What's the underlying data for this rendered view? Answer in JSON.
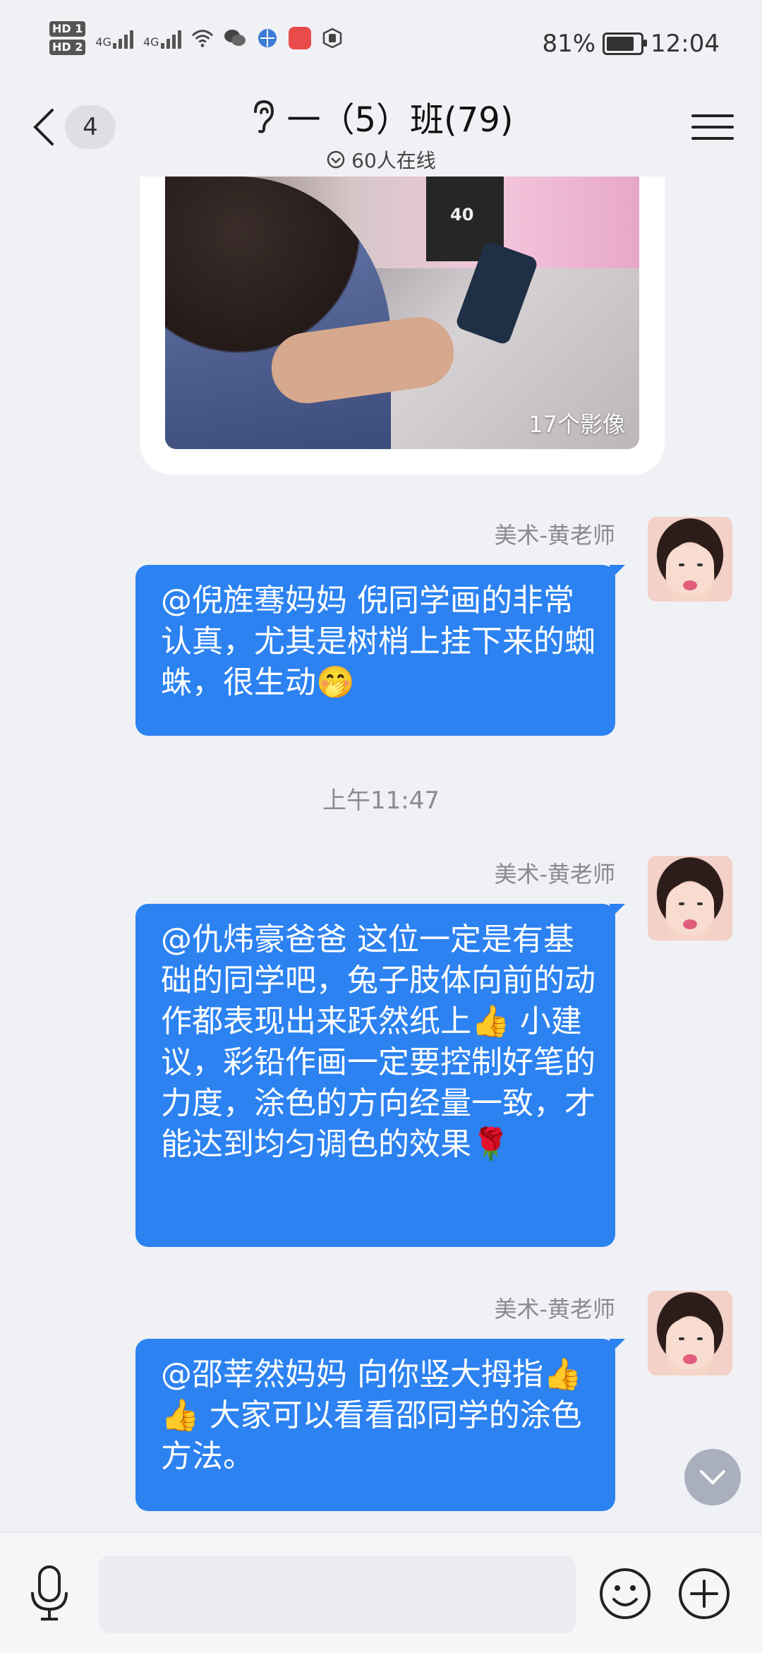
{
  "status_bar": {
    "hd1": "HD 1",
    "hd2": "HD 2",
    "net1": "4G",
    "net2": "4G",
    "battery": "81%",
    "time": "12:04",
    "icons": [
      "wifi-icon",
      "wechat-icon",
      "browser-icon",
      "huawei-icon",
      "hand-icon"
    ]
  },
  "nav": {
    "back_count": "4",
    "title": "一（5）班(79)",
    "online": "60人在线",
    "icons": {
      "ear": "ear-icon",
      "menu": "menu-icon",
      "online": "check-circle-icon"
    }
  },
  "image_message": {
    "count_label": "17个影像",
    "box_text": "40"
  },
  "messages": [
    {
      "sender": "美术-黄老师",
      "text": "@倪旌骞妈妈 倪同学画的非常认真，尤其是树梢上挂下来的蜘蛛，很生动🤭"
    },
    {
      "sender": "美术-黄老师",
      "text": "@仇炜豪爸爸 这位一定是有基础的同学吧，兔子肢体向前的动作都表现出来跃然纸上👍 小建议，彩铅作画一定要控制好笔的力度，涂色的方向经量一致，才能达到均匀调色的效果🌹"
    },
    {
      "sender": "美术-黄老师",
      "text": "@邵莘然妈妈 向你竖大拇指👍👍 大家可以看看邵同学的涂色方法。"
    }
  ],
  "timestamp": "上午11:47",
  "input": {
    "placeholder": "",
    "value": ""
  },
  "colors": {
    "bubble": "#2c82f1",
    "background": "#f0f1f5"
  }
}
